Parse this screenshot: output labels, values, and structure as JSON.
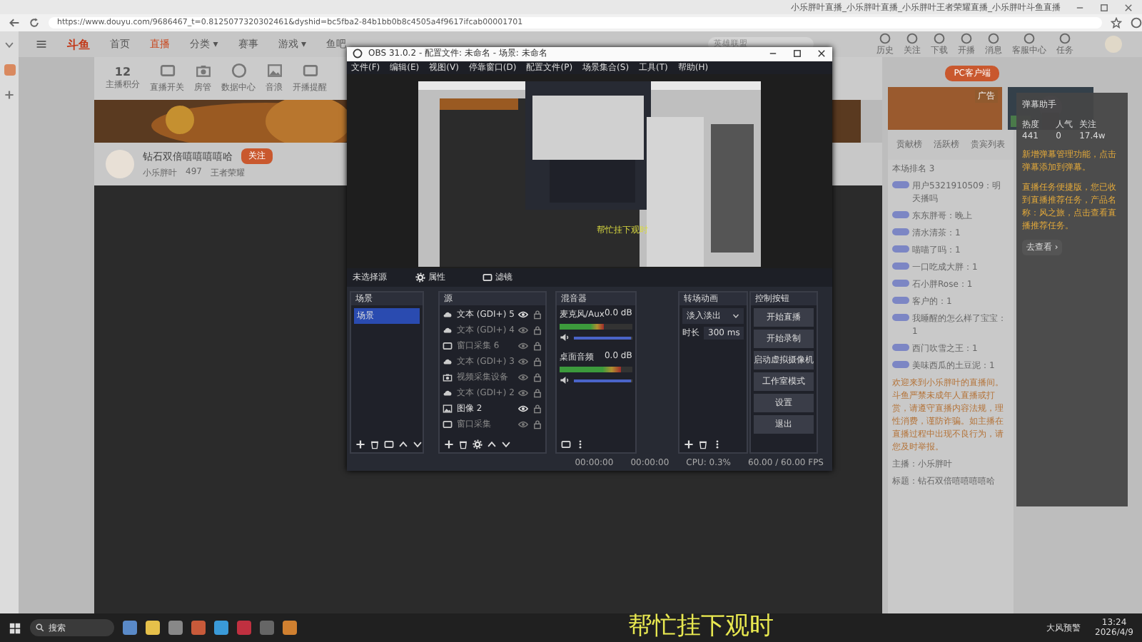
{
  "browser": {
    "tab_title": "小乐胖叶直播_小乐胖叶直播_小乐胖叶王者荣耀直播_小乐胖叶斗鱼直播",
    "url": "https://www.douyu.com/9686467_t=0.8125077320302461&dyshid=bc5fba2-84b1bb0b8c4505a4f9617ifcab00001701"
  },
  "site": {
    "logo": "斗鱼",
    "nav": [
      {
        "label": "首页",
        "selected": false
      },
      {
        "label": "直播",
        "selected": true
      },
      {
        "label": "分类 ▾",
        "selected": false
      },
      {
        "label": "赛事",
        "selected": false
      },
      {
        "label": "游戏 ▾",
        "selected": false
      },
      {
        "label": "鱼吧",
        "selected": false
      }
    ],
    "search": {
      "placeholder": "英雄联盟"
    },
    "header_icons": [
      "历史",
      "关注",
      "下载",
      "开播",
      "消息",
      "客服中心",
      "任务"
    ],
    "quick_bar": {
      "points": "12",
      "points_label": "主播积分",
      "items": [
        "直播开关",
        "房管",
        "数据中心",
        "音浪",
        "开播提醒"
      ]
    },
    "pc_button": "PC客户端",
    "streamer": {
      "name": "钻石双倍嘻嘻嘻嘻哈",
      "follow": "关注",
      "anchor": "小乐胖叶",
      "count": "497",
      "category": "王者荣耀"
    },
    "ad_badge": "广告",
    "chat_tabs": [
      "贡献榜",
      "活跃榜",
      "贵宾列表"
    ],
    "rank": "本场排名 3",
    "messages": [
      {
        "kind": "chat",
        "text": "用户5321910509：明天播吗"
      },
      {
        "kind": "chat",
        "text": "东东胖哥：晚上"
      },
      {
        "kind": "chat",
        "text": "清水清茶：1"
      },
      {
        "kind": "chat",
        "text": "喵喵了吗：1"
      },
      {
        "kind": "chat",
        "text": "一口吃成大胖：1"
      },
      {
        "kind": "chat",
        "text": "石小胖Rose：1"
      },
      {
        "kind": "chat",
        "text": "客户的：1"
      },
      {
        "kind": "chat",
        "text": "我睡醒的怎么样了宝宝：1"
      },
      {
        "kind": "chat",
        "text": "西门吹雪之王：1"
      },
      {
        "kind": "chat",
        "text": "美味西瓜的土豆泥：1"
      },
      {
        "kind": "notice",
        "text": "欢迎来到小乐胖叶的直播间。斗鱼严禁未成年人直播或打赏，请遵守直播内容法规，理性消费，谨防诈骗。如主播在直播过程中出现不良行为，请您及时举报。"
      },
      {
        "kind": "info",
        "text": "主播：小乐胖叶"
      },
      {
        "kind": "info",
        "text": "标题：钻石双倍嘻嘻嘻嘻哈"
      }
    ]
  },
  "assistant": {
    "title": "弹幕助手",
    "stats": [
      "热度 441",
      "人气 0",
      "关注 17.4w"
    ],
    "tips": [
      "新增弹幕管理功能，点击弹幕添加到弹幕。",
      "直播任务便捷版，您已收到直播推荐任务，产品名称：风之旅，点击查看直播推荐任务。"
    ],
    "link": "去查看 ›"
  },
  "obs": {
    "title": "OBS 31.0.2 - 配置文件: 未命名 - 场景: 未命名",
    "menu": [
      "文件(F)",
      "编辑(E)",
      "视图(V)",
      "停靠窗口(D)",
      "配置文件(P)",
      "场景集合(S)",
      "工具(T)",
      "帮助(H)"
    ],
    "preview_caption": "帮忙挂下观时",
    "source_bar": {
      "status": "未选择源",
      "buttons": [
        "属性",
        "滤镜"
      ]
    },
    "scenes": {
      "title": "场景",
      "items": [
        {
          "label": "场景",
          "selected": true
        }
      ]
    },
    "sources": {
      "title": "源",
      "items": [
        {
          "label": "文本 (GDI+) 5",
          "visible": true
        },
        {
          "label": "文本 (GDI+) 4",
          "visible": false
        },
        {
          "label": "窗口采集 6",
          "visible": false
        },
        {
          "label": "文本 (GDI+) 3",
          "visible": false
        },
        {
          "label": "视频采集设备",
          "visible": false
        },
        {
          "label": "文本 (GDI+) 2",
          "visible": false
        },
        {
          "label": "图像 2",
          "visible": true
        },
        {
          "label": "窗口采集",
          "visible": false
        }
      ]
    },
    "mixer": {
      "title": "混音器",
      "channels": [
        {
          "name": "麦克风/Aux",
          "reading": "0.0 dB",
          "meter": {
            "level": 0.6
          },
          "volume": {
            "level": 0.98
          }
        },
        {
          "name": "桌面音频",
          "reading": "0.0 dB",
          "meter": {
            "level": 0.85
          },
          "volume": {
            "level": 0.98
          }
        }
      ]
    },
    "transitions": {
      "title": "转场动画",
      "type": "淡入淡出",
      "duration_label": "时长",
      "duration": "300 ms"
    },
    "controls": {
      "title": "控制按钮",
      "buttons": [
        "开始直播",
        "开始录制",
        "启动虚拟摄像机",
        "工作室模式",
        "设置",
        "退出"
      ]
    },
    "status": [
      "00:00:00",
      "00:00:00",
      "CPU: 0.3%",
      "60.00 / 60.00 FPS"
    ]
  },
  "subtitle": "帮忙挂下观时",
  "taskbar": {
    "search": "搜索",
    "weather": "大风预警",
    "time": "13:24",
    "date": "2026/4/9"
  }
}
